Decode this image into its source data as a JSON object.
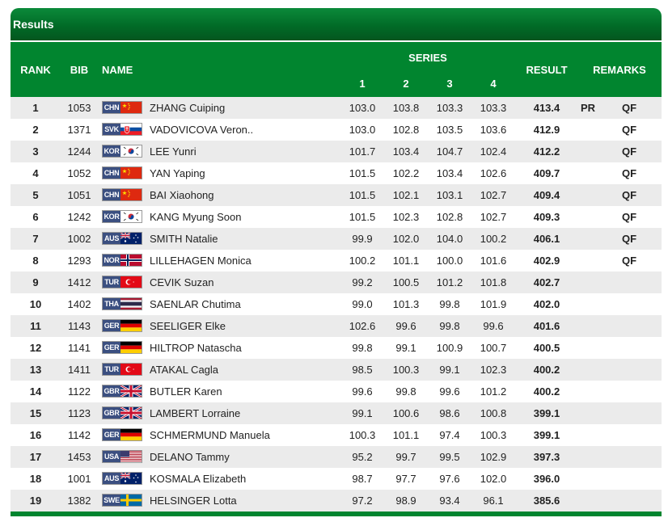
{
  "panel": {
    "title": "Results"
  },
  "header": {
    "rank": "RANK",
    "bib": "BIB",
    "name": "NAME",
    "series": "SERIES",
    "s1": "1",
    "s2": "2",
    "s3": "3",
    "s4": "4",
    "result": "RESULT",
    "remarks": "REMARKS"
  },
  "rows": [
    {
      "rank": "1",
      "bib": "1053",
      "country": "CHN",
      "flag": "china-flag-icon",
      "name": "ZHANG Cuiping",
      "s1": "103.0",
      "s2": "103.8",
      "s3": "103.3",
      "s4": "103.3",
      "result": "413.4",
      "record": "PR",
      "qual": "QF"
    },
    {
      "rank": "2",
      "bib": "1371",
      "country": "SVK",
      "flag": "slovakia-flag-icon",
      "name": "VADOVICOVA Veron..",
      "s1": "103.0",
      "s2": "102.8",
      "s3": "103.5",
      "s4": "103.6",
      "result": "412.9",
      "record": "",
      "qual": "QF"
    },
    {
      "rank": "3",
      "bib": "1244",
      "country": "KOR",
      "flag": "korea-flag-icon",
      "name": "LEE Yunri",
      "s1": "101.7",
      "s2": "103.4",
      "s3": "104.7",
      "s4": "102.4",
      "result": "412.2",
      "record": "",
      "qual": "QF"
    },
    {
      "rank": "4",
      "bib": "1052",
      "country": "CHN",
      "flag": "china-flag-icon",
      "name": "YAN Yaping",
      "s1": "101.5",
      "s2": "102.2",
      "s3": "103.4",
      "s4": "102.6",
      "result": "409.7",
      "record": "",
      "qual": "QF"
    },
    {
      "rank": "5",
      "bib": "1051",
      "country": "CHN",
      "flag": "china-flag-icon",
      "name": "BAI Xiaohong",
      "s1": "101.5",
      "s2": "102.1",
      "s3": "103.1",
      "s4": "102.7",
      "result": "409.4",
      "record": "",
      "qual": "QF"
    },
    {
      "rank": "6",
      "bib": "1242",
      "country": "KOR",
      "flag": "korea-flag-icon",
      "name": "KANG Myung Soon",
      "s1": "101.5",
      "s2": "102.3",
      "s3": "102.8",
      "s4": "102.7",
      "result": "409.3",
      "record": "",
      "qual": "QF"
    },
    {
      "rank": "7",
      "bib": "1002",
      "country": "AUS",
      "flag": "australia-flag-icon",
      "name": "SMITH Natalie",
      "s1": "99.9",
      "s2": "102.0",
      "s3": "104.0",
      "s4": "100.2",
      "result": "406.1",
      "record": "",
      "qual": "QF"
    },
    {
      "rank": "8",
      "bib": "1293",
      "country": "NOR",
      "flag": "norway-flag-icon",
      "name": "LILLEHAGEN Monica",
      "s1": "100.2",
      "s2": "101.1",
      "s3": "100.0",
      "s4": "101.6",
      "result": "402.9",
      "record": "",
      "qual": "QF"
    },
    {
      "rank": "9",
      "bib": "1412",
      "country": "TUR",
      "flag": "turkey-flag-icon",
      "name": "CEVIK Suzan",
      "s1": "99.2",
      "s2": "100.5",
      "s3": "101.2",
      "s4": "101.8",
      "result": "402.7",
      "record": "",
      "qual": ""
    },
    {
      "rank": "10",
      "bib": "1402",
      "country": "THA",
      "flag": "thailand-flag-icon",
      "name": "SAENLAR Chutima",
      "s1": "99.0",
      "s2": "101.3",
      "s3": "99.8",
      "s4": "101.9",
      "result": "402.0",
      "record": "",
      "qual": ""
    },
    {
      "rank": "11",
      "bib": "1143",
      "country": "GER",
      "flag": "germany-flag-icon",
      "name": "SEELIGER Elke",
      "s1": "102.6",
      "s2": "99.6",
      "s3": "99.8",
      "s4": "99.6",
      "result": "401.6",
      "record": "",
      "qual": ""
    },
    {
      "rank": "12",
      "bib": "1141",
      "country": "GER",
      "flag": "germany-flag-icon",
      "name": "HILTROP Natascha",
      "s1": "99.8",
      "s2": "99.1",
      "s3": "100.9",
      "s4": "100.7",
      "result": "400.5",
      "record": "",
      "qual": ""
    },
    {
      "rank": "13",
      "bib": "1411",
      "country": "TUR",
      "flag": "turkey-flag-icon",
      "name": "ATAKAL Cagla",
      "s1": "98.5",
      "s2": "100.3",
      "s3": "99.1",
      "s4": "102.3",
      "result": "400.2",
      "record": "",
      "qual": ""
    },
    {
      "rank": "14",
      "bib": "1122",
      "country": "GBR",
      "flag": "uk-flag-icon",
      "name": "BUTLER Karen",
      "s1": "99.6",
      "s2": "99.8",
      "s3": "99.6",
      "s4": "101.2",
      "result": "400.2",
      "record": "",
      "qual": ""
    },
    {
      "rank": "15",
      "bib": "1123",
      "country": "GBR",
      "flag": "uk-flag-icon",
      "name": "LAMBERT Lorraine",
      "s1": "99.1",
      "s2": "100.6",
      "s3": "98.6",
      "s4": "100.8",
      "result": "399.1",
      "record": "",
      "qual": ""
    },
    {
      "rank": "16",
      "bib": "1142",
      "country": "GER",
      "flag": "germany-flag-icon",
      "name": "SCHMERMUND Manuela",
      "s1": "100.3",
      "s2": "101.1",
      "s3": "97.4",
      "s4": "100.3",
      "result": "399.1",
      "record": "",
      "qual": ""
    },
    {
      "rank": "17",
      "bib": "1453",
      "country": "USA",
      "flag": "usa-flag-icon",
      "name": "DELANO Tammy",
      "s1": "95.2",
      "s2": "99.7",
      "s3": "99.5",
      "s4": "102.9",
      "result": "397.3",
      "record": "",
      "qual": ""
    },
    {
      "rank": "18",
      "bib": "1001",
      "country": "AUS",
      "flag": "australia-flag-icon",
      "name": "KOSMALA Elizabeth",
      "s1": "98.7",
      "s2": "97.7",
      "s3": "97.6",
      "s4": "102.0",
      "result": "396.0",
      "record": "",
      "qual": ""
    },
    {
      "rank": "19",
      "bib": "1382",
      "country": "SWE",
      "flag": "sweden-flag-icon",
      "name": "HELSINGER Lotta",
      "s1": "97.2",
      "s2": "98.9",
      "s3": "93.4",
      "s4": "96.1",
      "result": "385.6",
      "record": "",
      "qual": ""
    }
  ]
}
